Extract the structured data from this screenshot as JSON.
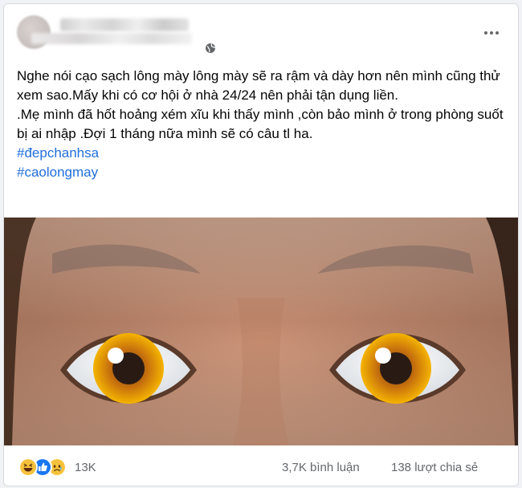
{
  "post": {
    "author_name": "Thảo Linh",
    "paragraphs": [
      "Nghe nói cạo sạch lông mày lông mày sẽ ra rậm và dày hơn nên mình cũng thử  xem sao.Mấy khi có cơ hội ở nhà 24/24 nên phải tận dụng liền.",
      ".Mẹ mình đã hốt hoảng xém xĩu khi thấy mình ,còn bảo mình ở trong phòng suốt bị ai nhập .Đợi 1 tháng nữa mình sẽ có câu tl ha."
    ],
    "hashtags": [
      "#đepchanhsa",
      "#caolongmay"
    ]
  },
  "footer": {
    "reaction_icons": [
      "haha-icon",
      "like-icon",
      "sad-icon"
    ],
    "reaction_count": "13K",
    "comments": "3,7K bình luận",
    "shares": "138 lượt chia sẻ"
  },
  "colors": {
    "hashtag": "#216fdb",
    "like": "#1877f2",
    "emoji_yellow": "#f7c23b"
  },
  "icons": {
    "privacy": "globe-icon",
    "menu": "more-options-icon",
    "eye_overlay": "eye-emoji"
  }
}
